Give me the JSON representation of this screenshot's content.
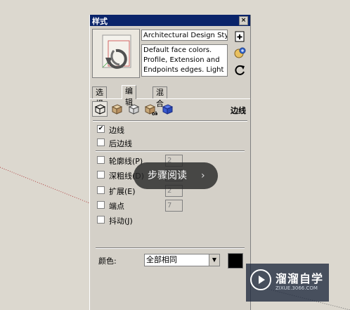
{
  "panel": {
    "title": "样式",
    "close_glyph": "×",
    "style_name": "Architectural Design Style",
    "style_description": "Default face colors. Profile, Extension and Endpoints edges. Light",
    "thumbnail_icon": "refresh-arrows-icon"
  },
  "tabs": [
    {
      "label": "选择",
      "active": false
    },
    {
      "label": "编辑",
      "active": true
    },
    {
      "label": "混合",
      "active": false
    }
  ],
  "toolbar": {
    "icons": [
      "edge-settings-icon",
      "face-settings-icon",
      "background-settings-icon",
      "watermark-settings-icon",
      "modeling-settings-icon"
    ],
    "section_label": "边线"
  },
  "edges": {
    "show_edges": {
      "label": "边线",
      "checked": true
    },
    "back_edges": {
      "label": "后边线",
      "checked": false
    },
    "profiles": {
      "label": "轮廓线(P)",
      "checked": false,
      "value": "2"
    },
    "depth_cue": {
      "label": "深粗线(D)",
      "checked": false,
      "value": "4"
    },
    "extension": {
      "label": "扩展(E)",
      "checked": false,
      "value": "2"
    },
    "endpoints": {
      "label": "端点",
      "checked": false,
      "value": "7"
    },
    "jitter": {
      "label": "抖动(J)",
      "checked": false
    }
  },
  "color": {
    "label": "颜色:",
    "selected": "全部相同",
    "swatch": "#000000"
  },
  "overlay": {
    "text": "步骤阅读",
    "chevron": "›"
  },
  "watermark": {
    "brand": "溜溜自学",
    "url": "ZIXUE.3066.COM"
  }
}
